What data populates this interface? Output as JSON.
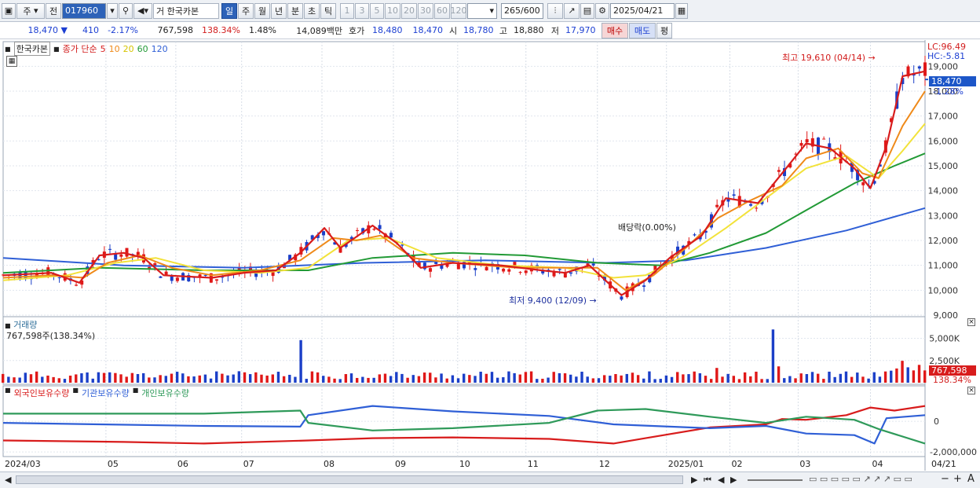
{
  "toolbar": {
    "market": "주",
    "prev": "전",
    "code": "017960",
    "type": "거",
    "name": "한국카본",
    "periods": [
      "일",
      "주",
      "월",
      "년",
      "분",
      "초",
      "틱"
    ],
    "active_period": "일",
    "intervals": [
      "1",
      "3",
      "5",
      "10",
      "20",
      "30",
      "60",
      "120"
    ],
    "count": "265",
    "total": "/600",
    "date": "2025/04/21"
  },
  "quote": {
    "price": "18,470",
    "change": "410",
    "change_pct": "-2.17%",
    "volume": "767,598",
    "volume_ratio": "138.34%",
    "turnover_pct": "1.48%",
    "amount": "14,089백만",
    "ask_label": "호가",
    "ask": "18,480",
    "bid": "18,470",
    "open_label": "시",
    "open": "18,780",
    "high_label": "고",
    "high": "18,880",
    "low_label": "저",
    "low": "17,970",
    "buy": "매수",
    "sell": "매도",
    "avg": "평"
  },
  "price_panel": {
    "name": "한국카본",
    "ma_label": "종가 단순",
    "ma_periods": [
      "5",
      "10",
      "20",
      "60",
      "120"
    ],
    "lc": "LC:96.49",
    "hc": "HC:-5.81",
    "last": "18,470",
    "last_pct": "-1.28%",
    "high_note": "최고 19,610 (04/14)",
    "low_note": "최저 9,400 (12/09)",
    "div_note": "배당락(0.00%)",
    "y_ticks": [
      "19,000",
      "18,000",
      "17,000",
      "16,000",
      "15,000",
      "14,000",
      "13,000",
      "12,000",
      "11,000",
      "10,000",
      "9,000"
    ]
  },
  "volume_panel": {
    "title": "거래량",
    "value": "767,598주(138.34%)",
    "y_ticks": [
      "5,000K",
      "2,500K"
    ],
    "last": "767,598",
    "last_pct": "138.34%"
  },
  "holding_panel": {
    "series": [
      "외국인보유수량",
      "기관보유수량",
      "개인보유수량"
    ],
    "y_ticks": [
      "0",
      "-2,000,000"
    ]
  },
  "x_axis": [
    "2024/03",
    "05",
    "06",
    "07",
    "08",
    "09",
    "10",
    "11",
    "12",
    "2025/01",
    "02",
    "03",
    "04",
    "04/21"
  ],
  "colors": {
    "up": "#e01818",
    "down": "#1b3fc8",
    "ma5": "#d81c1c",
    "ma10": "#ef8a1a",
    "ma20": "#f2e23a",
    "ma60": "#229a36",
    "ma120": "#2f5fd6",
    "foreign": "#d81c1c",
    "inst": "#2f5fd6",
    "indiv": "#2f9a5a"
  },
  "chart_data": {
    "type": "line",
    "title": "한국카본",
    "price_ylim": [
      9000,
      19800
    ],
    "ma": {
      "ma5": [
        [
          0,
          10600
        ],
        [
          60,
          10700
        ],
        [
          95,
          10300
        ],
        [
          120,
          11400
        ],
        [
          150,
          11500
        ],
        [
          175,
          11300
        ],
        [
          200,
          10600
        ],
        [
          260,
          10500
        ],
        [
          300,
          10700
        ],
        [
          340,
          10800
        ],
        [
          370,
          11500
        ],
        [
          400,
          12500
        ],
        [
          420,
          11700
        ],
        [
          460,
          12600
        ],
        [
          490,
          11900
        ],
        [
          520,
          10900
        ],
        [
          560,
          11100
        ],
        [
          620,
          11000
        ],
        [
          670,
          10800
        ],
        [
          700,
          10700
        ],
        [
          730,
          11000
        ],
        [
          770,
          9800
        ],
        [
          800,
          10400
        ],
        [
          830,
          11300
        ],
        [
          870,
          12200
        ],
        [
          900,
          13700
        ],
        [
          940,
          13500
        ],
        [
          970,
          14700
        ],
        [
          1000,
          15900
        ],
        [
          1030,
          15700
        ],
        [
          1060,
          14900
        ],
        [
          1080,
          14100
        ],
        [
          1100,
          15800
        ],
        [
          1120,
          18600
        ],
        [
          1148,
          18800
        ]
      ],
      "ma10": [
        [
          0,
          10500
        ],
        [
          60,
          10600
        ],
        [
          100,
          10500
        ],
        [
          130,
          11100
        ],
        [
          170,
          11400
        ],
        [
          210,
          10900
        ],
        [
          260,
          10600
        ],
        [
          320,
          10800
        ],
        [
          370,
          11200
        ],
        [
          410,
          12100
        ],
        [
          440,
          12000
        ],
        [
          470,
          12200
        ],
        [
          510,
          11300
        ],
        [
          560,
          11100
        ],
        [
          640,
          10900
        ],
        [
          700,
          10900
        ],
        [
          740,
          10900
        ],
        [
          775,
          10000
        ],
        [
          810,
          10600
        ],
        [
          850,
          11700
        ],
        [
          890,
          12900
        ],
        [
          930,
          13600
        ],
        [
          970,
          14200
        ],
        [
          1000,
          15300
        ],
        [
          1040,
          15700
        ],
        [
          1070,
          14700
        ],
        [
          1090,
          14500
        ],
        [
          1120,
          16600
        ],
        [
          1148,
          18000
        ]
      ],
      "ma20": [
        [
          0,
          10400
        ],
        [
          80,
          10600
        ],
        [
          140,
          11100
        ],
        [
          190,
          11300
        ],
        [
          250,
          10800
        ],
        [
          320,
          10700
        ],
        [
          380,
          10900
        ],
        [
          430,
          12000
        ],
        [
          480,
          12100
        ],
        [
          540,
          11300
        ],
        [
          620,
          11000
        ],
        [
          700,
          10900
        ],
        [
          760,
          10500
        ],
        [
          800,
          10600
        ],
        [
          850,
          11400
        ],
        [
          900,
          12500
        ],
        [
          950,
          13700
        ],
        [
          1000,
          14900
        ],
        [
          1050,
          15400
        ],
        [
          1090,
          14500
        ],
        [
          1120,
          15600
        ],
        [
          1148,
          16700
        ]
      ],
      "ma60": [
        [
          0,
          10700
        ],
        [
          120,
          10900
        ],
        [
          250,
          10800
        ],
        [
          380,
          10800
        ],
        [
          460,
          11300
        ],
        [
          560,
          11500
        ],
        [
          650,
          11400
        ],
        [
          740,
          11100
        ],
        [
          820,
          11000
        ],
        [
          880,
          11500
        ],
        [
          950,
          12300
        ],
        [
          1010,
          13400
        ],
        [
          1060,
          14300
        ],
        [
          1110,
          15000
        ],
        [
          1148,
          15500
        ]
      ],
      "ma120": [
        [
          0,
          11300
        ],
        [
          150,
          11000
        ],
        [
          300,
          10900
        ],
        [
          450,
          11100
        ],
        [
          600,
          11200
        ],
        [
          750,
          11100
        ],
        [
          850,
          11200
        ],
        [
          950,
          11700
        ],
        [
          1050,
          12400
        ],
        [
          1148,
          13300
        ]
      ]
    },
    "holdings": {
      "foreign": [
        [
          0,
          -1250000
        ],
        [
          150,
          -1350000
        ],
        [
          250,
          -1450000
        ],
        [
          380,
          -1250000
        ],
        [
          460,
          -1100000
        ],
        [
          560,
          -1050000
        ],
        [
          680,
          -1150000
        ],
        [
          760,
          -1450000
        ],
        [
          800,
          -1100000
        ],
        [
          880,
          -400000
        ],
        [
          950,
          -200000
        ],
        [
          970,
          150000
        ],
        [
          1000,
          100000
        ],
        [
          1050,
          400000
        ],
        [
          1080,
          900000
        ],
        [
          1110,
          700000
        ],
        [
          1148,
          1000000
        ]
      ],
      "inst": [
        [
          0,
          -100000
        ],
        [
          120,
          -200000
        ],
        [
          250,
          -300000
        ],
        [
          370,
          -350000
        ],
        [
          380,
          400000
        ],
        [
          460,
          1000000
        ],
        [
          560,
          650000
        ],
        [
          680,
          350000
        ],
        [
          760,
          -200000
        ],
        [
          880,
          -450000
        ],
        [
          950,
          -300000
        ],
        [
          1000,
          -800000
        ],
        [
          1060,
          -900000
        ],
        [
          1085,
          -1450000
        ],
        [
          1100,
          200000
        ],
        [
          1148,
          400000
        ]
      ],
      "indiv": [
        [
          0,
          500000
        ],
        [
          150,
          500000
        ],
        [
          250,
          500000
        ],
        [
          370,
          700000
        ],
        [
          380,
          -100000
        ],
        [
          460,
          -600000
        ],
        [
          560,
          -450000
        ],
        [
          680,
          -100000
        ],
        [
          740,
          700000
        ],
        [
          800,
          800000
        ],
        [
          880,
          300000
        ],
        [
          950,
          -100000
        ],
        [
          1000,
          300000
        ],
        [
          1060,
          100000
        ],
        [
          1090,
          -500000
        ],
        [
          1148,
          -1450000
        ]
      ]
    },
    "holdings_ylim": [
      -2200000,
      1700000
    ]
  }
}
